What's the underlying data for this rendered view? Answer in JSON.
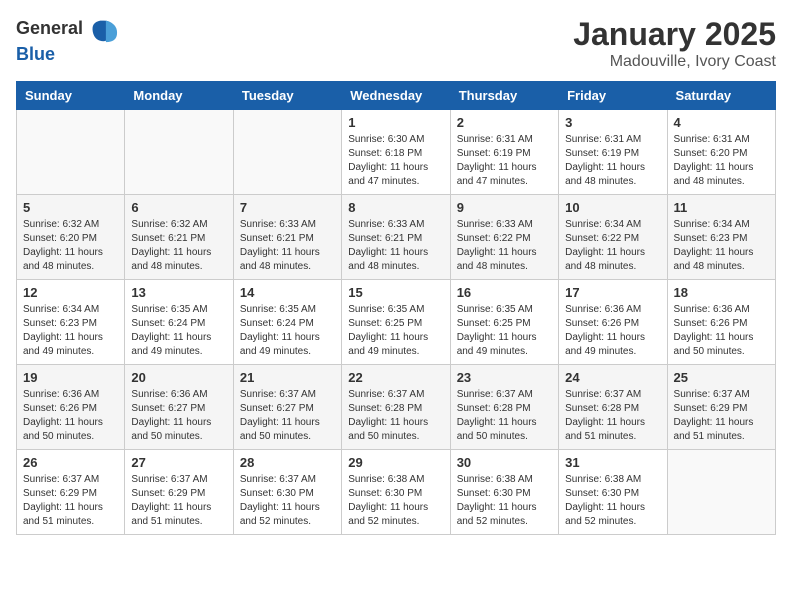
{
  "header": {
    "logo_general": "General",
    "logo_blue": "Blue",
    "month": "January 2025",
    "location": "Madouville, Ivory Coast"
  },
  "days_of_week": [
    "Sunday",
    "Monday",
    "Tuesday",
    "Wednesday",
    "Thursday",
    "Friday",
    "Saturday"
  ],
  "weeks": [
    [
      {
        "day": "",
        "info": ""
      },
      {
        "day": "",
        "info": ""
      },
      {
        "day": "",
        "info": ""
      },
      {
        "day": "1",
        "info": "Sunrise: 6:30 AM\nSunset: 6:18 PM\nDaylight: 11 hours and 47 minutes."
      },
      {
        "day": "2",
        "info": "Sunrise: 6:31 AM\nSunset: 6:19 PM\nDaylight: 11 hours and 47 minutes."
      },
      {
        "day": "3",
        "info": "Sunrise: 6:31 AM\nSunset: 6:19 PM\nDaylight: 11 hours and 48 minutes."
      },
      {
        "day": "4",
        "info": "Sunrise: 6:31 AM\nSunset: 6:20 PM\nDaylight: 11 hours and 48 minutes."
      }
    ],
    [
      {
        "day": "5",
        "info": "Sunrise: 6:32 AM\nSunset: 6:20 PM\nDaylight: 11 hours and 48 minutes."
      },
      {
        "day": "6",
        "info": "Sunrise: 6:32 AM\nSunset: 6:21 PM\nDaylight: 11 hours and 48 minutes."
      },
      {
        "day": "7",
        "info": "Sunrise: 6:33 AM\nSunset: 6:21 PM\nDaylight: 11 hours and 48 minutes."
      },
      {
        "day": "8",
        "info": "Sunrise: 6:33 AM\nSunset: 6:21 PM\nDaylight: 11 hours and 48 minutes."
      },
      {
        "day": "9",
        "info": "Sunrise: 6:33 AM\nSunset: 6:22 PM\nDaylight: 11 hours and 48 minutes."
      },
      {
        "day": "10",
        "info": "Sunrise: 6:34 AM\nSunset: 6:22 PM\nDaylight: 11 hours and 48 minutes."
      },
      {
        "day": "11",
        "info": "Sunrise: 6:34 AM\nSunset: 6:23 PM\nDaylight: 11 hours and 48 minutes."
      }
    ],
    [
      {
        "day": "12",
        "info": "Sunrise: 6:34 AM\nSunset: 6:23 PM\nDaylight: 11 hours and 49 minutes."
      },
      {
        "day": "13",
        "info": "Sunrise: 6:35 AM\nSunset: 6:24 PM\nDaylight: 11 hours and 49 minutes."
      },
      {
        "day": "14",
        "info": "Sunrise: 6:35 AM\nSunset: 6:24 PM\nDaylight: 11 hours and 49 minutes."
      },
      {
        "day": "15",
        "info": "Sunrise: 6:35 AM\nSunset: 6:25 PM\nDaylight: 11 hours and 49 minutes."
      },
      {
        "day": "16",
        "info": "Sunrise: 6:35 AM\nSunset: 6:25 PM\nDaylight: 11 hours and 49 minutes."
      },
      {
        "day": "17",
        "info": "Sunrise: 6:36 AM\nSunset: 6:26 PM\nDaylight: 11 hours and 49 minutes."
      },
      {
        "day": "18",
        "info": "Sunrise: 6:36 AM\nSunset: 6:26 PM\nDaylight: 11 hours and 50 minutes."
      }
    ],
    [
      {
        "day": "19",
        "info": "Sunrise: 6:36 AM\nSunset: 6:26 PM\nDaylight: 11 hours and 50 minutes."
      },
      {
        "day": "20",
        "info": "Sunrise: 6:36 AM\nSunset: 6:27 PM\nDaylight: 11 hours and 50 minutes."
      },
      {
        "day": "21",
        "info": "Sunrise: 6:37 AM\nSunset: 6:27 PM\nDaylight: 11 hours and 50 minutes."
      },
      {
        "day": "22",
        "info": "Sunrise: 6:37 AM\nSunset: 6:28 PM\nDaylight: 11 hours and 50 minutes."
      },
      {
        "day": "23",
        "info": "Sunrise: 6:37 AM\nSunset: 6:28 PM\nDaylight: 11 hours and 50 minutes."
      },
      {
        "day": "24",
        "info": "Sunrise: 6:37 AM\nSunset: 6:28 PM\nDaylight: 11 hours and 51 minutes."
      },
      {
        "day": "25",
        "info": "Sunrise: 6:37 AM\nSunset: 6:29 PM\nDaylight: 11 hours and 51 minutes."
      }
    ],
    [
      {
        "day": "26",
        "info": "Sunrise: 6:37 AM\nSunset: 6:29 PM\nDaylight: 11 hours and 51 minutes."
      },
      {
        "day": "27",
        "info": "Sunrise: 6:37 AM\nSunset: 6:29 PM\nDaylight: 11 hours and 51 minutes."
      },
      {
        "day": "28",
        "info": "Sunrise: 6:37 AM\nSunset: 6:30 PM\nDaylight: 11 hours and 52 minutes."
      },
      {
        "day": "29",
        "info": "Sunrise: 6:38 AM\nSunset: 6:30 PM\nDaylight: 11 hours and 52 minutes."
      },
      {
        "day": "30",
        "info": "Sunrise: 6:38 AM\nSunset: 6:30 PM\nDaylight: 11 hours and 52 minutes."
      },
      {
        "day": "31",
        "info": "Sunrise: 6:38 AM\nSunset: 6:30 PM\nDaylight: 11 hours and 52 minutes."
      },
      {
        "day": "",
        "info": ""
      }
    ]
  ]
}
